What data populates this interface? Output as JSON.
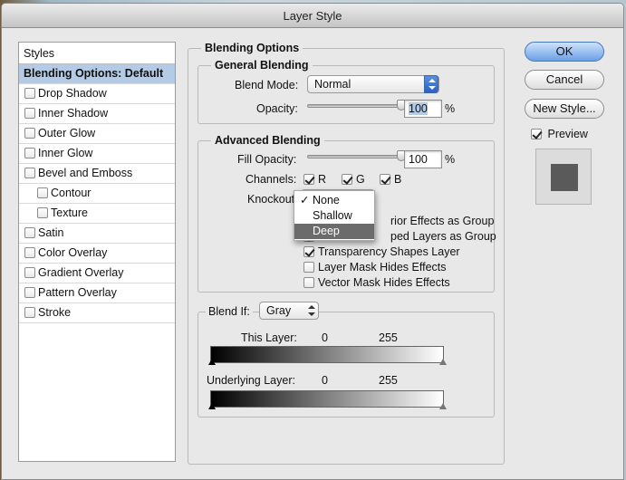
{
  "window": {
    "title": "Layer Style"
  },
  "styles_panel": {
    "header": "Styles",
    "items": [
      {
        "label": "Blending Options: Default",
        "selected": true,
        "checkbox": false,
        "indent": 0
      },
      {
        "label": "Drop Shadow",
        "checkbox": true,
        "checked": false,
        "indent": 0
      },
      {
        "label": "Inner Shadow",
        "checkbox": true,
        "checked": false,
        "indent": 0
      },
      {
        "label": "Outer Glow",
        "checkbox": true,
        "checked": false,
        "indent": 0
      },
      {
        "label": "Inner Glow",
        "checkbox": true,
        "checked": false,
        "indent": 0
      },
      {
        "label": "Bevel and Emboss",
        "checkbox": true,
        "checked": false,
        "indent": 0
      },
      {
        "label": "Contour",
        "checkbox": true,
        "checked": false,
        "indent": 1
      },
      {
        "label": "Texture",
        "checkbox": true,
        "checked": false,
        "indent": 1
      },
      {
        "label": "Satin",
        "checkbox": true,
        "checked": false,
        "indent": 0
      },
      {
        "label": "Color Overlay",
        "checkbox": true,
        "checked": false,
        "indent": 0
      },
      {
        "label": "Gradient Overlay",
        "checkbox": true,
        "checked": false,
        "indent": 0
      },
      {
        "label": "Pattern Overlay",
        "checkbox": true,
        "checked": false,
        "indent": 0
      },
      {
        "label": "Stroke",
        "checkbox": true,
        "checked": false,
        "indent": 0
      }
    ]
  },
  "blending_options": {
    "title": "Blending Options",
    "general": {
      "title": "General Blending",
      "blend_mode_label": "Blend Mode:",
      "blend_mode_value": "Normal",
      "opacity_label": "Opacity:",
      "opacity_value": "100",
      "opacity_unit": "%",
      "opacity_fraction": 1.0
    },
    "advanced": {
      "title": "Advanced Blending",
      "fill_opacity_label": "Fill Opacity:",
      "fill_opacity_value": "100",
      "fill_opacity_unit": "%",
      "fill_opacity_fraction": 1.0,
      "channels_label": "Channels:",
      "channels": [
        {
          "label": "R",
          "checked": true
        },
        {
          "label": "G",
          "checked": true
        },
        {
          "label": "B",
          "checked": true
        }
      ],
      "knockout_label": "Knockout",
      "knockout_menu": [
        {
          "label": "None",
          "checked": true,
          "highlighted": false
        },
        {
          "label": "Shallow",
          "checked": false,
          "highlighted": false
        },
        {
          "label": "Deep",
          "checked": false,
          "highlighted": true
        }
      ],
      "options": [
        {
          "label": "Blend Interior Effects as Group",
          "visible_label": "rior Effects as Group",
          "checked": false
        },
        {
          "label": "Blend Clipped Layers as Group",
          "visible_label": "ped Layers as Group",
          "checked": true
        },
        {
          "label": "Transparency Shapes Layer",
          "checked": true
        },
        {
          "label": "Layer Mask Hides Effects",
          "checked": false
        },
        {
          "label": "Vector Mask Hides Effects",
          "checked": false
        }
      ],
      "check_glyph": "✓"
    },
    "blend_if": {
      "label": "Blend If:",
      "value": "Gray",
      "this_layer_label": "This Layer:",
      "this_layer_min": "0",
      "this_layer_max": "255",
      "underlying_label": "Underlying Layer:",
      "underlying_min": "0",
      "underlying_max": "255"
    }
  },
  "buttons": {
    "ok": "OK",
    "cancel": "Cancel",
    "new_style": "New Style...",
    "preview_label": "Preview",
    "preview_checked": true
  },
  "colors": {
    "selection": "#b3cbe6",
    "default_button": "#6aa0e6",
    "menu_highlight": "#6b6b6b",
    "preview_swatch": "#5a5a5a"
  }
}
